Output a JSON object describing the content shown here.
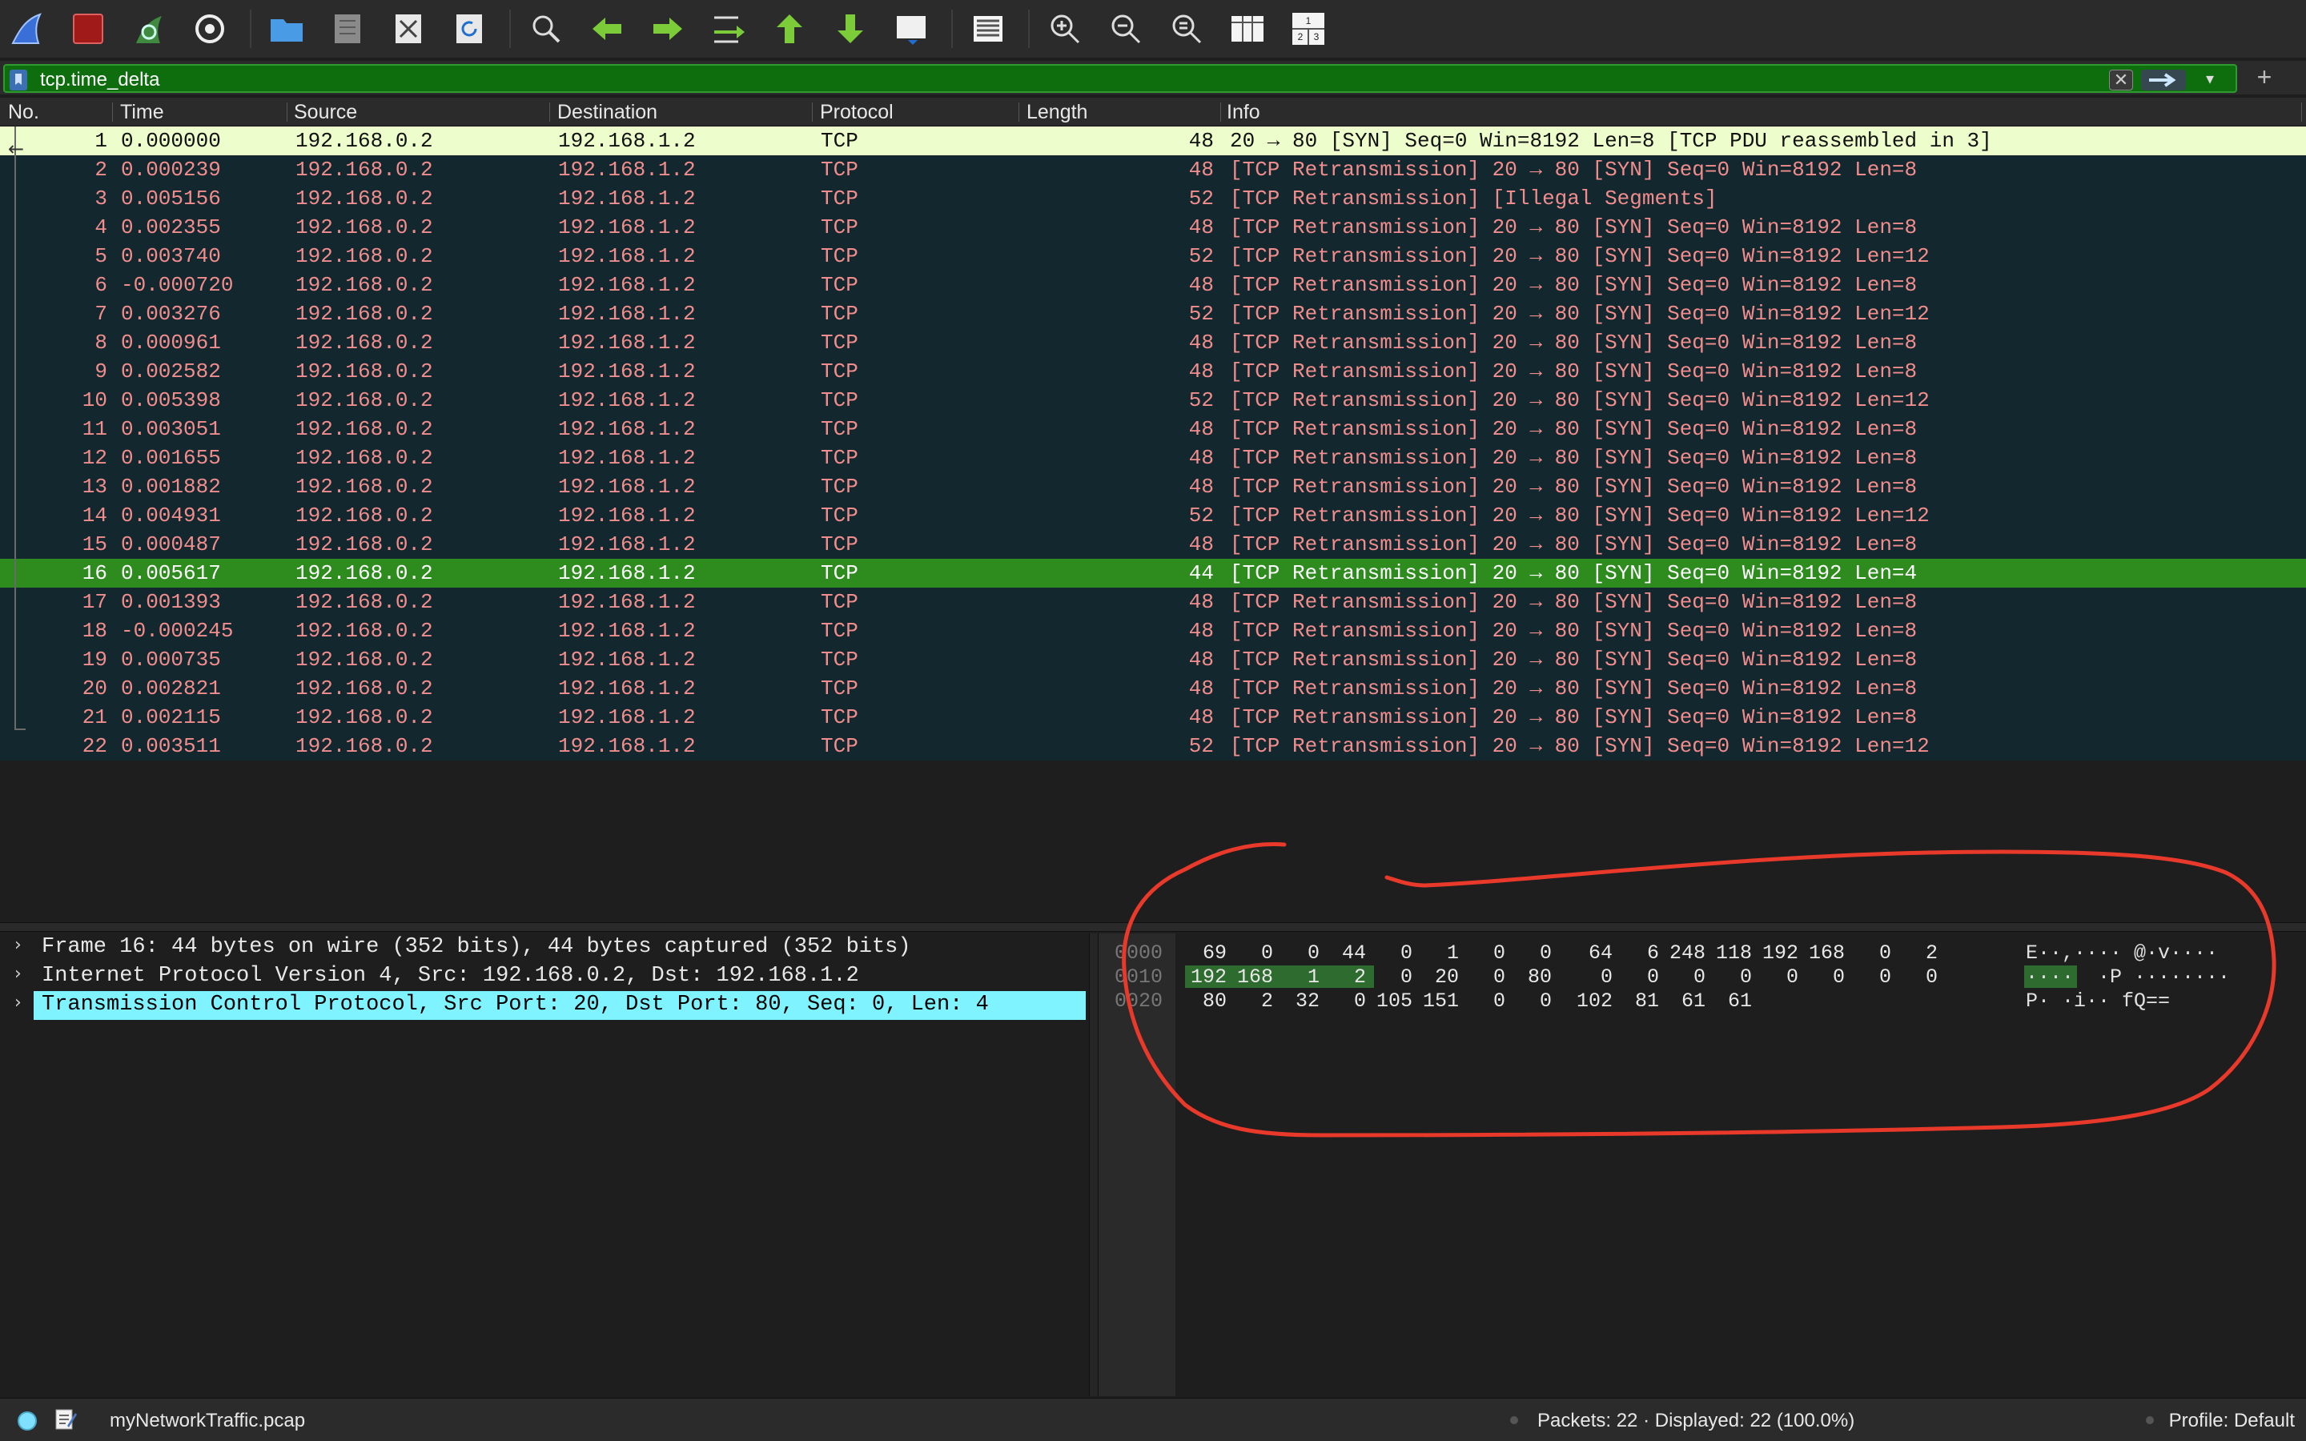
{
  "toolbar": {
    "icons": [
      "shark-fin-icon",
      "stop-capture-icon",
      "restart-capture-icon",
      "capture-options-icon",
      "open-file-icon",
      "save-file-icon",
      "close-file-icon",
      "reload-file-icon",
      "find-packet-icon",
      "go-back-icon",
      "go-forward-icon",
      "go-to-packet-icon",
      "go-first-icon",
      "go-last-icon",
      "auto-scroll-icon",
      "colorize-icon",
      "zoom-in-icon",
      "zoom-out-icon",
      "normal-size-icon",
      "resize-columns-icon",
      "layout-icon"
    ],
    "layout_labels": [
      "1",
      "2",
      "3"
    ]
  },
  "filter": {
    "text": "tcp.time_delta",
    "clear_label": "✕",
    "dropdown_label": "▾",
    "plus_label": "+",
    "accent": "#0e6e0e"
  },
  "packet_list": {
    "columns": [
      "No.",
      "Time",
      "Source",
      "Destination",
      "Protocol",
      "Length",
      "Info"
    ],
    "rows": [
      {
        "no": "1",
        "time": "0.000000",
        "src": "192.168.0.2",
        "dst": "192.168.1.2",
        "proto": "TCP",
        "len": "48",
        "info": "20 → 80 [SYN] Seq=0 Win=8192 Len=8 [TCP PDU reassembled in 3]"
      },
      {
        "no": "2",
        "time": "0.000239",
        "src": "192.168.0.2",
        "dst": "192.168.1.2",
        "proto": "TCP",
        "len": "48",
        "info": "[TCP Retransmission] 20 → 80 [SYN] Seq=0 Win=8192 Len=8"
      },
      {
        "no": "3",
        "time": "0.005156",
        "src": "192.168.0.2",
        "dst": "192.168.1.2",
        "proto": "TCP",
        "len": "52",
        "info": "[TCP Retransmission] [Illegal Segments]"
      },
      {
        "no": "4",
        "time": "0.002355",
        "src": "192.168.0.2",
        "dst": "192.168.1.2",
        "proto": "TCP",
        "len": "48",
        "info": "[TCP Retransmission] 20 → 80 [SYN] Seq=0 Win=8192 Len=8"
      },
      {
        "no": "5",
        "time": "0.003740",
        "src": "192.168.0.2",
        "dst": "192.168.1.2",
        "proto": "TCP",
        "len": "52",
        "info": "[TCP Retransmission] 20 → 80 [SYN] Seq=0 Win=8192 Len=12"
      },
      {
        "no": "6",
        "time": "-0.000720",
        "src": "192.168.0.2",
        "dst": "192.168.1.2",
        "proto": "TCP",
        "len": "48",
        "info": "[TCP Retransmission] 20 → 80 [SYN] Seq=0 Win=8192 Len=8"
      },
      {
        "no": "7",
        "time": "0.003276",
        "src": "192.168.0.2",
        "dst": "192.168.1.2",
        "proto": "TCP",
        "len": "52",
        "info": "[TCP Retransmission] 20 → 80 [SYN] Seq=0 Win=8192 Len=12"
      },
      {
        "no": "8",
        "time": "0.000961",
        "src": "192.168.0.2",
        "dst": "192.168.1.2",
        "proto": "TCP",
        "len": "48",
        "info": "[TCP Retransmission] 20 → 80 [SYN] Seq=0 Win=8192 Len=8"
      },
      {
        "no": "9",
        "time": "0.002582",
        "src": "192.168.0.2",
        "dst": "192.168.1.2",
        "proto": "TCP",
        "len": "48",
        "info": "[TCP Retransmission] 20 → 80 [SYN] Seq=0 Win=8192 Len=8"
      },
      {
        "no": "10",
        "time": "0.005398",
        "src": "192.168.0.2",
        "dst": "192.168.1.2",
        "proto": "TCP",
        "len": "52",
        "info": "[TCP Retransmission] 20 → 80 [SYN] Seq=0 Win=8192 Len=12"
      },
      {
        "no": "11",
        "time": "0.003051",
        "src": "192.168.0.2",
        "dst": "192.168.1.2",
        "proto": "TCP",
        "len": "48",
        "info": "[TCP Retransmission] 20 → 80 [SYN] Seq=0 Win=8192 Len=8"
      },
      {
        "no": "12",
        "time": "0.001655",
        "src": "192.168.0.2",
        "dst": "192.168.1.2",
        "proto": "TCP",
        "len": "48",
        "info": "[TCP Retransmission] 20 → 80 [SYN] Seq=0 Win=8192 Len=8"
      },
      {
        "no": "13",
        "time": "0.001882",
        "src": "192.168.0.2",
        "dst": "192.168.1.2",
        "proto": "TCP",
        "len": "48",
        "info": "[TCP Retransmission] 20 → 80 [SYN] Seq=0 Win=8192 Len=8"
      },
      {
        "no": "14",
        "time": "0.004931",
        "src": "192.168.0.2",
        "dst": "192.168.1.2",
        "proto": "TCP",
        "len": "52",
        "info": "[TCP Retransmission] 20 → 80 [SYN] Seq=0 Win=8192 Len=12"
      },
      {
        "no": "15",
        "time": "0.000487",
        "src": "192.168.0.2",
        "dst": "192.168.1.2",
        "proto": "TCP",
        "len": "48",
        "info": "[TCP Retransmission] 20 → 80 [SYN] Seq=0 Win=8192 Len=8"
      },
      {
        "no": "16",
        "time": "0.005617",
        "src": "192.168.0.2",
        "dst": "192.168.1.2",
        "proto": "TCP",
        "len": "44",
        "info": "[TCP Retransmission] 20 → 80 [SYN] Seq=0 Win=8192 Len=4"
      },
      {
        "no": "17",
        "time": "0.001393",
        "src": "192.168.0.2",
        "dst": "192.168.1.2",
        "proto": "TCP",
        "len": "48",
        "info": "[TCP Retransmission] 20 → 80 [SYN] Seq=0 Win=8192 Len=8"
      },
      {
        "no": "18",
        "time": "-0.000245",
        "src": "192.168.0.2",
        "dst": "192.168.1.2",
        "proto": "TCP",
        "len": "48",
        "info": "[TCP Retransmission] 20 → 80 [SYN] Seq=0 Win=8192 Len=8"
      },
      {
        "no": "19",
        "time": "0.000735",
        "src": "192.168.0.2",
        "dst": "192.168.1.2",
        "proto": "TCP",
        "len": "48",
        "info": "[TCP Retransmission] 20 → 80 [SYN] Seq=0 Win=8192 Len=8"
      },
      {
        "no": "20",
        "time": "0.002821",
        "src": "192.168.0.2",
        "dst": "192.168.1.2",
        "proto": "TCP",
        "len": "48",
        "info": "[TCP Retransmission] 20 → 80 [SYN] Seq=0 Win=8192 Len=8"
      },
      {
        "no": "21",
        "time": "0.002115",
        "src": "192.168.0.2",
        "dst": "192.168.1.2",
        "proto": "TCP",
        "len": "48",
        "info": "[TCP Retransmission] 20 → 80 [SYN] Seq=0 Win=8192 Len=8"
      },
      {
        "no": "22",
        "time": "0.003511",
        "src": "192.168.0.2",
        "dst": "192.168.1.2",
        "proto": "TCP",
        "len": "52",
        "info": "[TCP Retransmission] 20 → 80 [SYN] Seq=0 Win=8192 Len=12"
      }
    ],
    "selected_no": "16",
    "colors": {
      "row_bg": "#12272e",
      "row_text": "#f18d8d",
      "first_bg": "#eefdcc",
      "selected_bg": "#2e8b1e"
    }
  },
  "details": {
    "items": [
      {
        "arrow": "›",
        "text": "Frame 16: 44 bytes on wire (352 bits), 44 bytes captured (352 bits)"
      },
      {
        "arrow": "›",
        "text": "Internet Protocol Version 4, Src: 192.168.0.2, Dst: 192.168.1.2"
      },
      {
        "arrow": "›",
        "text": "Transmission Control Protocol, Src Port: 20, Dst Port: 80, Seq: 0, Len: 4"
      }
    ],
    "selected_color": "#7ff3ff"
  },
  "bytes": {
    "rows": [
      {
        "offset": "0000",
        "values": [
          "69",
          "0",
          "0",
          "44",
          "0",
          "1",
          "0",
          "0",
          "64",
          "6",
          "248",
          "118",
          "192",
          "168",
          "0",
          "2"
        ],
        "ascii": "E··,···· @·v····"
      },
      {
        "offset": "0010",
        "values": [
          "192",
          "168",
          "1",
          "2",
          "0",
          "20",
          "0",
          "80",
          "0",
          "0",
          "0",
          "0",
          "0",
          "0",
          "0",
          "0"
        ],
        "ascii": "····  ·P ········"
      },
      {
        "offset": "0020",
        "values": [
          "80",
          "2",
          "32",
          "0",
          "105",
          "151",
          "0",
          "0",
          "102",
          "81",
          "61",
          "61"
        ],
        "ascii": "P· ·i·· fQ=="
      }
    ],
    "highlight": {
      "row": 1,
      "from": 0,
      "to": 3
    }
  },
  "annotation": {
    "color": "#e8392a",
    "label": "red hand-drawn circle around hex bytes"
  },
  "status": {
    "file": "myNetworkTraffic.pcap",
    "packets": "Packets: 22 · Displayed: 22 (100.0%)",
    "profile": "Profile: Default"
  }
}
